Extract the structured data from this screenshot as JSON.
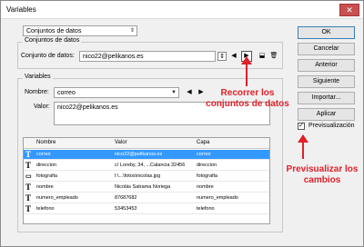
{
  "window": {
    "title": "Variables",
    "close_glyph": "✕"
  },
  "top_select": {
    "value": "Conjuntos de datos"
  },
  "datasets_group": {
    "label": "Conjuntos de datos",
    "field_label": "Conjunto de datos:",
    "value": "nico22@pelikanos.es"
  },
  "variables_group": {
    "label": "Variables",
    "name_label": "Nombre:",
    "name_value": "correo",
    "value_label": "Valor:",
    "value_text": "nico22@pelikanos.es"
  },
  "table": {
    "columns": [
      "Nombre",
      "Valor",
      "Capa"
    ],
    "rows": [
      {
        "icon": "T",
        "name": "correo",
        "value": "nico22@pelikanos.es",
        "layer": "correo",
        "selected": true
      },
      {
        "icon": "T",
        "name": "direccion",
        "value": "c/ Loreby, 34, ...Calancia 32456",
        "layer": "direccion",
        "selected": false
      },
      {
        "icon": "img",
        "name": "fotografia",
        "value": "I:\\...\\fotos\\nicolas.jpg",
        "layer": "fotografia",
        "selected": false
      },
      {
        "icon": "T",
        "name": "nombre",
        "value": "Nicolás Satrama Noriega",
        "layer": "nombre",
        "selected": false
      },
      {
        "icon": "T",
        "name": "numero_empleado",
        "value": "87687682",
        "layer": "numero_empleado",
        "selected": false
      },
      {
        "icon": "T",
        "name": "telefono",
        "value": "53453453",
        "layer": "telefono",
        "selected": false
      }
    ]
  },
  "buttons": {
    "ok": "OK",
    "cancel": "Cancelar",
    "prev": "Anterior",
    "next": "Siguiente",
    "import": "Importar...",
    "apply": "Aplicar"
  },
  "preview": {
    "label": "Previsualización",
    "checked": true,
    "check_glyph": "✓"
  },
  "annotations": {
    "browse": "Recorrer los conjuntos de datos",
    "preview": "Previsualizar los cambios"
  },
  "colors": {
    "selection": "#3399ff",
    "annotation": "#e0202a"
  }
}
